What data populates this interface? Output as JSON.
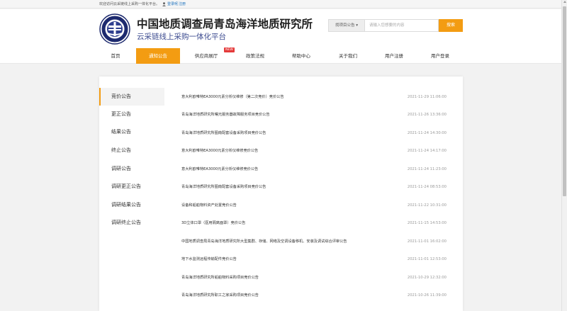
{
  "topbar": {
    "welcome": "欢迎访问云采链线上采购一体化平台。",
    "login": "登录呢",
    "register": "注册"
  },
  "header": {
    "title": "中国地质调查局青岛海洋地质研究所",
    "subtitle": "云采链线上采购一体化平台"
  },
  "search": {
    "type_label": "找项目公告 ▾",
    "placeholder": "请输入您想要的内容",
    "button": "搜索"
  },
  "nav": {
    "items": [
      {
        "label": "首页",
        "active": false
      },
      {
        "label": "通知公告",
        "active": true
      },
      {
        "label": "供应商展厅",
        "active": false
      },
      {
        "label": "政策法规",
        "active": false
      },
      {
        "label": "帮助中心",
        "active": false
      },
      {
        "label": "关于我们",
        "active": false
      },
      {
        "label": "用户注册",
        "active": false
      },
      {
        "label": "用户登录",
        "active": false
      }
    ],
    "badge": "NEW"
  },
  "sidebar": {
    "items": [
      {
        "label": "竞价公告",
        "active": true
      },
      {
        "label": "更正公告",
        "active": false
      },
      {
        "label": "结果公告",
        "active": false
      },
      {
        "label": "终止公告",
        "active": false
      },
      {
        "label": "调研公告",
        "active": false
      },
      {
        "label": "调研更正公告",
        "active": false
      },
      {
        "label": "调研结果公告",
        "active": false
      },
      {
        "label": "调研终止公告",
        "active": false
      }
    ]
  },
  "list": [
    {
      "title": "意大利欧唯特EA3000元素分析仪维修（第二次竞价）竞价公告",
      "date": "2021-11-29 11:06:00"
    },
    {
      "title": "青岛海洋地质研究所曙光服务器故障服务项目竞价公告",
      "date": "2021-11-26 13:36:00"
    },
    {
      "title": "青岛海洋地质研究所图南配套设备采购项目竞价公告",
      "date": "2021-11-24 14:30:00"
    },
    {
      "title": "意大利欧唯特EA3000元素分析仪维修竞价公告",
      "date": "2021-11-24 14:17:00"
    },
    {
      "title": "意大利欧唯特EA3000元素分析仪维修竞价公告",
      "date": "2021-11-24 11:23:00"
    },
    {
      "title": "青岛海洋地质研究所图南配套设备采购项目竞价公告",
      "date": "2021-11-24 08:53:00"
    },
    {
      "title": "设备和船舶物料资产处置竞价公告",
      "date": "2021-11-22 10:31:00"
    },
    {
      "title": "3D立体口罩（医用隔离面罩）竞价公告",
      "date": "2021-11-15 14:53:00"
    },
    {
      "title": "中国地质调查局青岛海洋地质研究所大型集群、存储、网络及空调设备移机、安装及调试综合评审公告",
      "date": "2021-11-01 16:02:00"
    },
    {
      "title": "地下水监测远程传输配件竞价公告",
      "date": "2021-11-01 12:53:00"
    },
    {
      "title": "青岛海洋地质研究所船舶物料采购项目竞价公告",
      "date": "2021-10-29 12:32:00"
    },
    {
      "title": "青岛海洋地质研究所职工之家采购项目竞价公告",
      "date": "2021-10-26 11:39:00"
    }
  ],
  "colors": {
    "accent": "#f39c12",
    "badge": "#e43a3a",
    "link": "#1e73be",
    "subtitle": "#3b4a8f"
  }
}
